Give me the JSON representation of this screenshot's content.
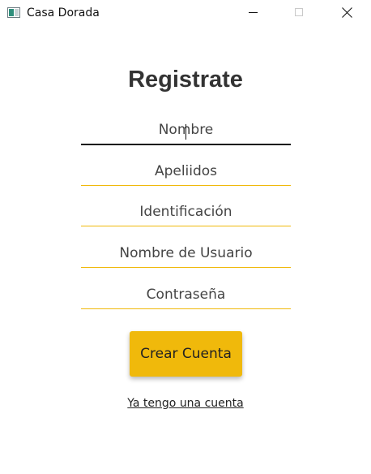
{
  "window": {
    "title": "Casa Dorada",
    "icon": "app-window-icon",
    "controls": [
      "minimize-icon",
      "maximize-icon",
      "close-icon"
    ]
  },
  "form": {
    "heading": "Registrate",
    "fields": [
      {
        "name": "nombre",
        "placeholder": "Nombre",
        "value": "",
        "focused": true
      },
      {
        "name": "apellidos",
        "placeholder": "Apeliidos",
        "value": "",
        "focused": false
      },
      {
        "name": "identificacion",
        "placeholder": "Identificación",
        "value": "",
        "focused": false
      },
      {
        "name": "usuario",
        "placeholder": "Nombre de Usuario",
        "value": "",
        "focused": false
      },
      {
        "name": "contrasena",
        "placeholder": "Contraseña",
        "value": "",
        "focused": false
      }
    ],
    "submit_label": "Crear Cuenta",
    "login_link": "Ya tengo una cuenta"
  },
  "colors": {
    "accent": "#f0b90b",
    "focused_underline": "#111111",
    "text": "#333333",
    "background": "#ffffff"
  }
}
